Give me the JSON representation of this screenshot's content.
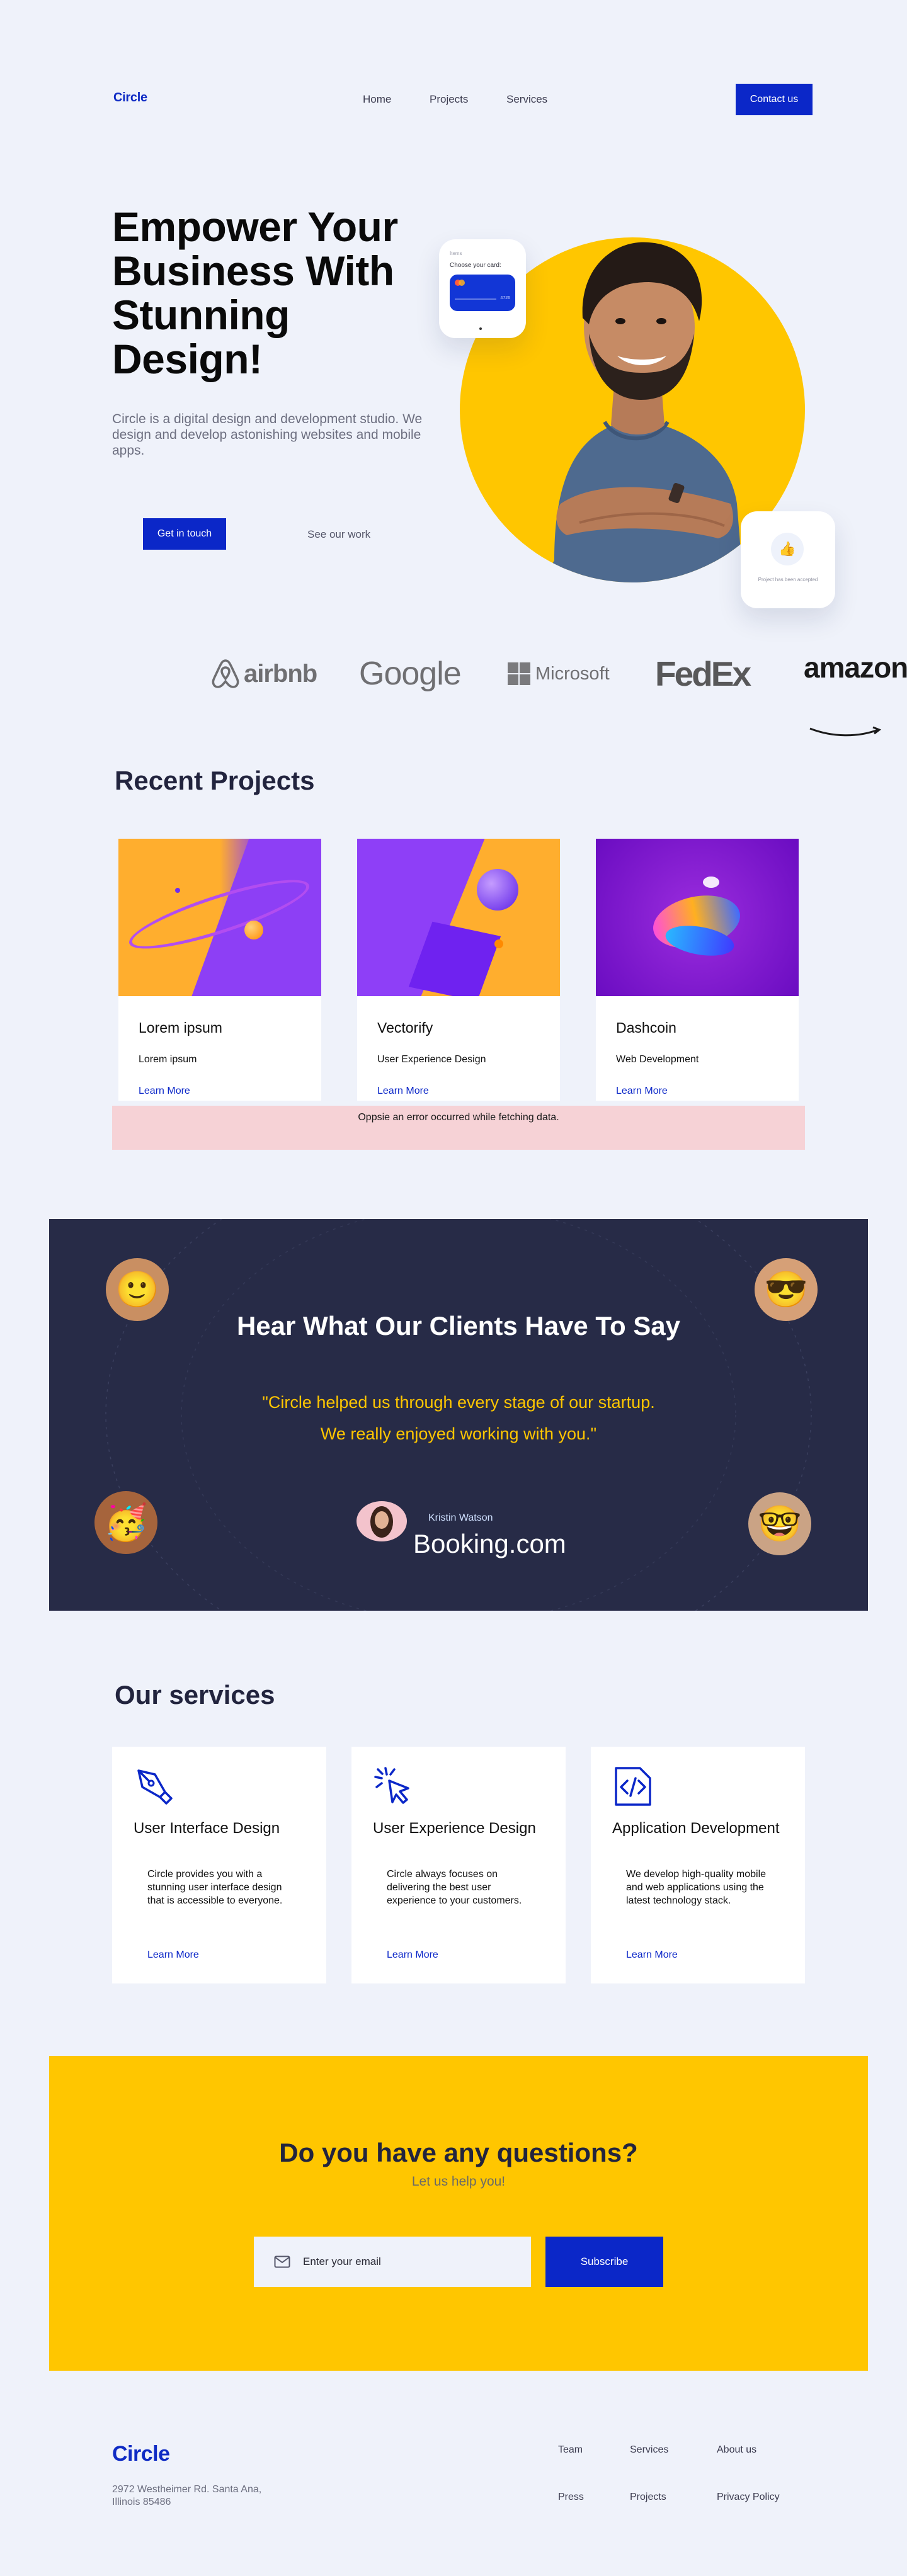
{
  "nav": {
    "logo": "Circle",
    "links": [
      "Home",
      "Projects",
      "Services"
    ],
    "cta": "Contact us"
  },
  "hero": {
    "title": "Empower Your Business With Stunning Design!",
    "description": "Circle is a digital design and development studio. We design and develop astonishing websites and mobile apps.",
    "primary_button": "Get in touch",
    "secondary_link": "See our work",
    "payment_card": {
      "label": "Items",
      "title": "Choose your card:",
      "card_number": "4726"
    },
    "notification": {
      "text": "Project has been accepted"
    }
  },
  "brands": [
    "airbnb",
    "Google",
    "Microsoft",
    "FedEx",
    "amazon"
  ],
  "projects": {
    "title": "Recent Projects",
    "items": [
      {
        "title": "Lorem ipsum",
        "subtitle": "Lorem ipsum",
        "link": "Learn More"
      },
      {
        "title": "Vectorify",
        "subtitle": "User Experience Design",
        "link": "Learn More"
      },
      {
        "title": "Dashcoin",
        "subtitle": "Web Development",
        "link": "Learn More"
      }
    ],
    "error": "Oppsie an error occurred while fetching data."
  },
  "testimonials": {
    "title": "Hear What Our Clients Have To Say",
    "quote_line1": "\"Circle helped us through every stage of our startup.",
    "quote_line2": "We really enjoyed working with you.\"",
    "author": "Kristin Watson",
    "company": "Booking.com"
  },
  "services": {
    "title": "Our services",
    "items": [
      {
        "icon": "pen-tool-icon",
        "title": "User Interface Design",
        "description": "Circle provides you with a stunning user interface design that is accessible to everyone.",
        "link": "Learn More"
      },
      {
        "icon": "cursor-click-icon",
        "title": "User Experience Design",
        "description": "Circle always focuses on delivering the best user experience to your customers.",
        "link": "Learn More"
      },
      {
        "icon": "code-file-icon",
        "title": "Application Development",
        "description": "We develop high-quality mobile and web applications using the latest technology stack.",
        "link": "Learn More"
      }
    ]
  },
  "cta": {
    "title": "Do you have any questions?",
    "subtitle": "Let us help you!",
    "email_placeholder": "Enter your email",
    "button": "Subscribe"
  },
  "footer": {
    "logo": "Circle",
    "address": "2972 Westheimer Rd. Santa Ana, Illinois 85486",
    "col1": [
      "Team",
      "Press"
    ],
    "col2": [
      "Services",
      "Projects"
    ],
    "col3": [
      "About us",
      "Privacy Policy"
    ]
  },
  "colors": {
    "brand_blue": "#0b27c8",
    "accent_yellow": "#ffc600",
    "dark_navy": "#272b47",
    "background": "#eff2fa",
    "error_bg": "#f6d2d6"
  }
}
